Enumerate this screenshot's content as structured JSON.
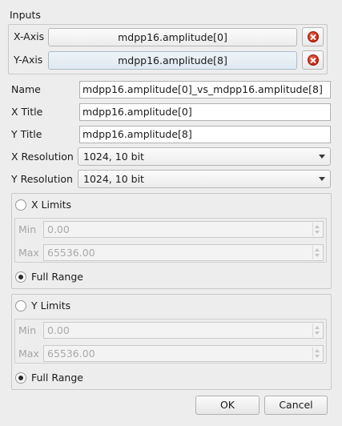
{
  "inputs": {
    "title": "Inputs",
    "x_axis": {
      "label": "X-Axis",
      "value": "mdpp16.amplitude[0]"
    },
    "y_axis": {
      "label": "Y-Axis",
      "value": "mdpp16.amplitude[8]"
    }
  },
  "form": {
    "name": {
      "label": "Name",
      "value": "mdpp16.amplitude[0]_vs_mdpp16.amplitude[8]"
    },
    "x_title": {
      "label": "X Title",
      "value": "mdpp16.amplitude[0]"
    },
    "y_title": {
      "label": "Y Title",
      "value": "mdpp16.amplitude[8]"
    },
    "x_resolution": {
      "label": "X Resolution",
      "value": "1024, 10 bit"
    },
    "y_resolution": {
      "label": "Y Resolution",
      "value": "1024, 10 bit"
    }
  },
  "x_limits": {
    "radio_label": "X Limits",
    "min_label": "Min",
    "min_value": "0.00",
    "max_label": "Max",
    "max_value": "65536.00",
    "full_range_label": "Full Range"
  },
  "y_limits": {
    "radio_label": "Y Limits",
    "min_label": "Min",
    "min_value": "0.00",
    "max_label": "Max",
    "max_value": "65536.00",
    "full_range_label": "Full Range"
  },
  "buttons": {
    "ok": "OK",
    "cancel": "Cancel"
  }
}
